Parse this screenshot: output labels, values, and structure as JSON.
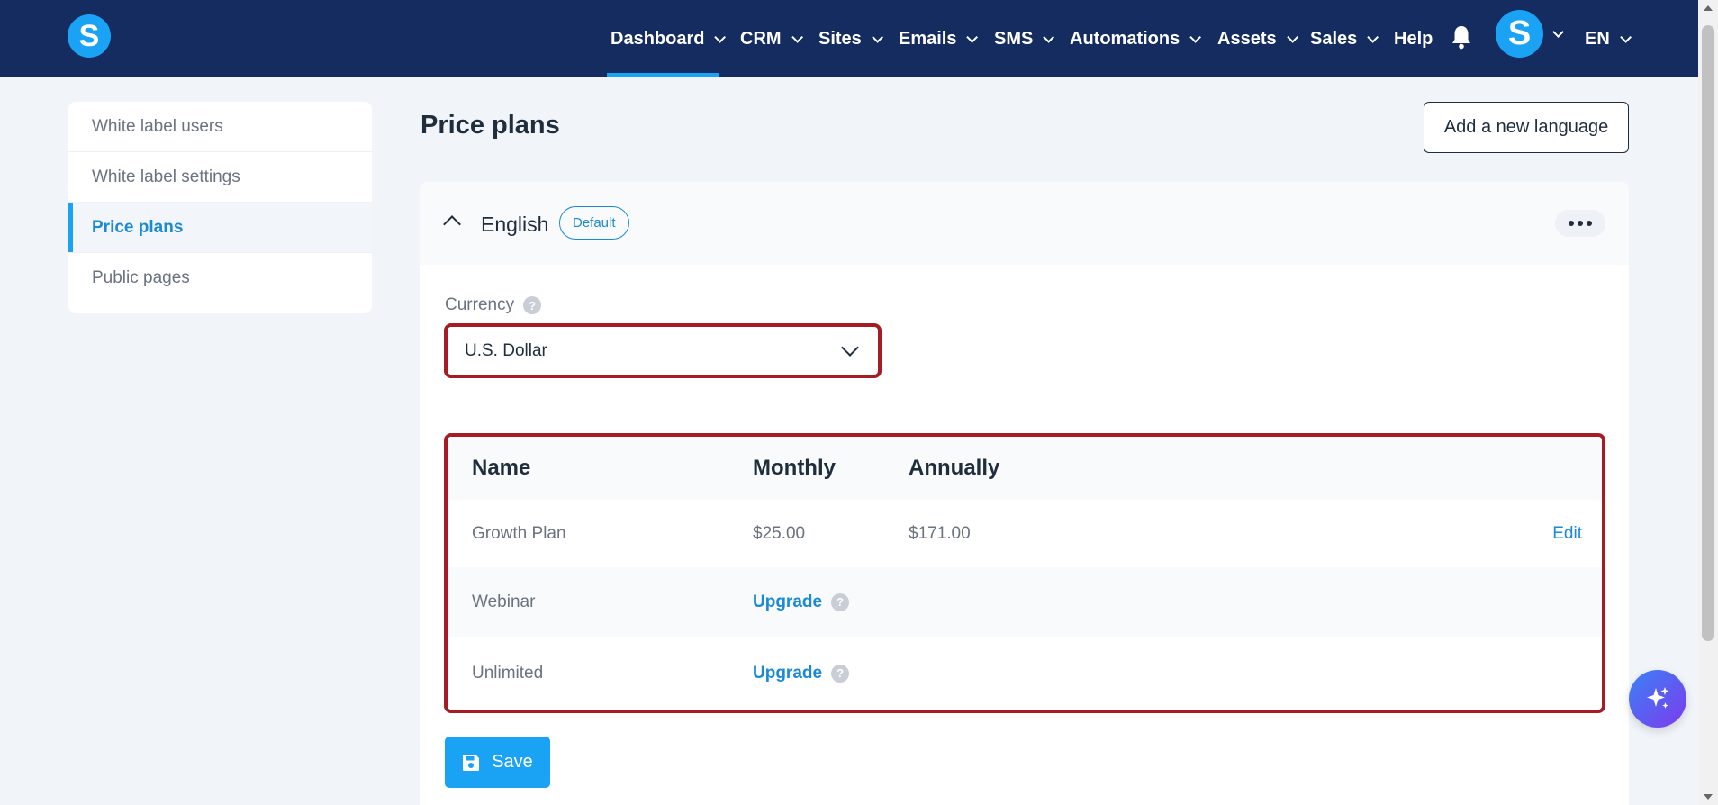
{
  "brand": {
    "logo_letter": "S"
  },
  "nav": {
    "items": [
      {
        "label": "Dashboard"
      },
      {
        "label": "CRM"
      },
      {
        "label": "Sites"
      },
      {
        "label": "Emails"
      },
      {
        "label": "SMS"
      },
      {
        "label": "Automations"
      },
      {
        "label": "Assets"
      },
      {
        "label": "Sales"
      },
      {
        "label": "Help"
      }
    ],
    "active": "Dashboard",
    "avatar_letter": "S",
    "language": "EN"
  },
  "sidebar": {
    "items": [
      {
        "label": "White label users"
      },
      {
        "label": "White label settings"
      },
      {
        "label": "Price plans"
      },
      {
        "label": "Public pages"
      }
    ],
    "active": "Price plans"
  },
  "page": {
    "title": "Price plans",
    "add_language_label": "Add a new language"
  },
  "language_section": {
    "name": "English",
    "badge": "Default",
    "currency_label": "Currency",
    "currency_help": "?",
    "currency_value": "U.S. Dollar"
  },
  "plans_table": {
    "headers": {
      "name": "Name",
      "monthly": "Monthly",
      "annually": "Annually"
    },
    "rows": [
      {
        "name": "Growth Plan",
        "monthly": "$25.00",
        "annually": "$171.00",
        "action": "Edit"
      },
      {
        "name": "Webinar",
        "monthly": "Upgrade",
        "help": "?"
      },
      {
        "name": "Unlimited",
        "monthly": "Upgrade",
        "help": "?"
      }
    ]
  },
  "save_label": "Save",
  "colors": {
    "nav_bg": "#142c5f",
    "accent": "#1aa3f4",
    "link": "#1a8ad6",
    "highlight_border": "#a51c24"
  },
  "icons": [
    "bell-icon",
    "chevron-down-icon",
    "chevron-up-icon",
    "more-icon",
    "help-icon",
    "save-icon",
    "sparkle-icon"
  ]
}
